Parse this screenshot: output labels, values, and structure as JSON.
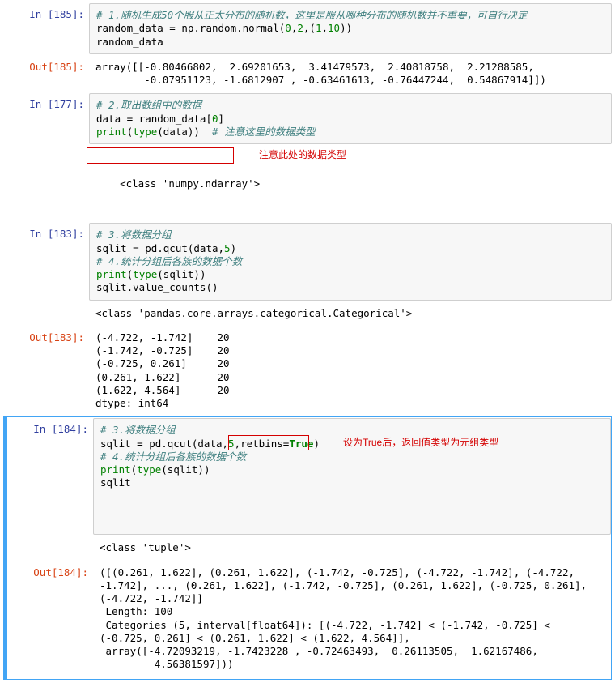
{
  "cell185": {
    "in_prompt": "In [185]:",
    "out_prompt": "Out[185]:",
    "code_comment1": "# 1.随机生成50个服从正太分布的随机数，这里是服从哪种分布的随机数并不重要，可自行决定",
    "code_l2a": "random_data = np.random.normal(",
    "code_l2_arg1": "0",
    "code_l2_sep1": ",",
    "code_l2_arg2": "2",
    "code_l2_sep2": ",(",
    "code_l2_arg3": "1",
    "code_l2_sep3": ",",
    "code_l2_arg4": "10",
    "code_l2_b": "))",
    "code_l3": "random_data",
    "out_text": "array([[-0.80466802,  2.69201653,  3.41479573,  2.40818758,  2.21288585,\n        -0.07951123, -1.6812907 , -0.63461613, -0.76447244,  0.54867914]])"
  },
  "cell177": {
    "in_prompt": "In [177]:",
    "code_comment1": "# 2.取出数组中的数据",
    "code_l2a": "data = random_data[",
    "code_l2_idx": "0",
    "code_l2b": "]",
    "code_l3a": "print",
    "code_l3b": "(",
    "code_l3c": "type",
    "code_l3d": "(data))  ",
    "code_comment2": "# 注意这里的数据类型",
    "stdout": "<class 'numpy.ndarray'>",
    "anno": "注意此处的数据类型"
  },
  "cell183": {
    "in_prompt": "In [183]:",
    "out_prompt": "Out[183]:",
    "code_comment1": "# 3.将数据分组",
    "code_l2a": "sqlit = pd.qcut(data,",
    "code_l2_n": "5",
    "code_l2b": ")",
    "code_comment2": "# 4.统计分组后各族的数据个数",
    "code_l4a": "print",
    "code_l4b": "(",
    "code_l4c": "type",
    "code_l4d": "(sqlit))",
    "code_l5": "sqlit.value_counts()",
    "stdout": "<class 'pandas.core.arrays.categorical.Categorical'>",
    "out_text": "(-4.722, -1.742]    20\n(-1.742, -0.725]    20\n(-0.725, 0.261]     20\n(0.261, 1.622]      20\n(1.622, 4.564]      20\ndtype: int64"
  },
  "cell184": {
    "in_prompt": "In [184]:",
    "out_prompt": "Out[184]:",
    "code_comment1": "# 3.将数据分组",
    "code_l2a": "sqlit = pd.qcut(data,",
    "code_l2_n": "5",
    "code_l2_sep": ",",
    "code_l2_kw": "retbins",
    "code_l2_eq": "=",
    "code_l2_true": "True",
    "code_l2b": ")",
    "code_comment2": "# 4.统计分组后各族的数据个数",
    "code_l4a": "print",
    "code_l4b": "(",
    "code_l4c": "type",
    "code_l4d": "(sqlit))",
    "code_l5": "sqlit",
    "anno": "设为True后，返回值类型为元组类型",
    "stdout": "<class 'tuple'>",
    "out_text": "([(0.261, 1.622], (0.261, 1.622], (-1.742, -0.725], (-4.722, -1.742], (-4.722, -1.742], ..., (0.261, 1.622], (-1.742, -0.725], (0.261, 1.622], (-0.725, 0.261], (-4.722, -1.742]]\n Length: 100\n Categories (5, interval[float64]): [(-4.722, -1.742] < (-1.742, -0.725] < (-0.725, 0.261] < (0.261, 1.622] < (1.622, 4.564]],\n array([-4.72093219, -1.7423228 , -0.72463493,  0.26113505,  1.62167486,\n         4.56381597]))"
  },
  "chart_data": {
    "type": "table",
    "title": "sqlit.value_counts()",
    "categories": [
      "(-4.722, -1.742]",
      "(-1.742, -0.725]",
      "(-0.725, 0.261]",
      "(0.261, 1.622]",
      "(1.622, 4.564]"
    ],
    "values": [
      20,
      20,
      20,
      20,
      20
    ],
    "dtype": "int64"
  }
}
